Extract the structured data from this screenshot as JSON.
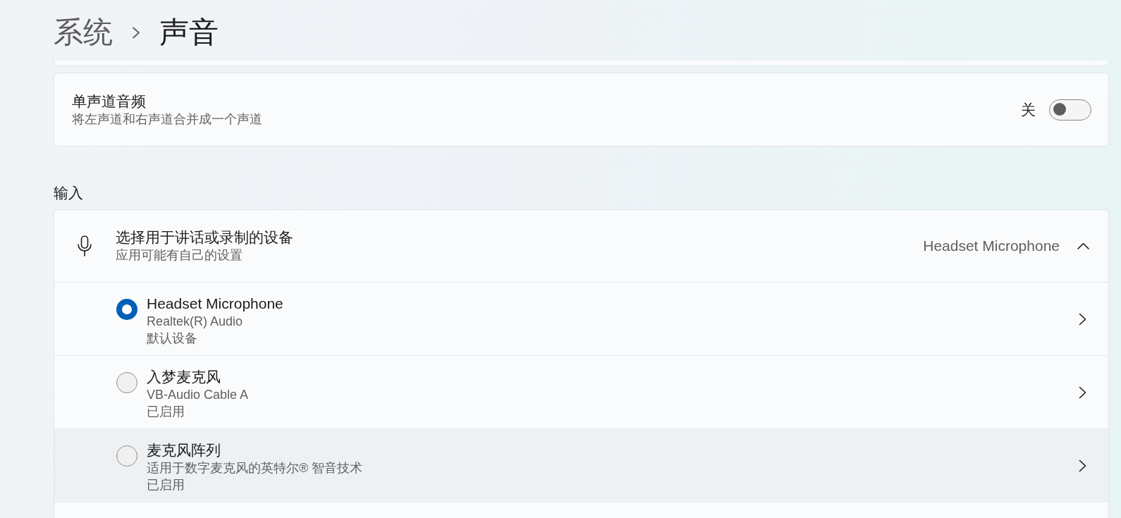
{
  "breadcrumb": [
    {
      "label": "系统",
      "current": false
    },
    {
      "label": "声音",
      "current": true
    }
  ],
  "settings": [
    {
      "kind": "toggle",
      "title": "单声道音频",
      "description": "将左声道和右声道合并成一个声道",
      "state_label": "关",
      "on": false
    }
  ],
  "input": {
    "heading": "输入",
    "picker": {
      "title": "选择用于讲话或录制的设备",
      "description": "应用可能有自己的设置",
      "value": "Headset Microphone",
      "expanded": true
    },
    "devices": [
      {
        "name": "Headset Microphone",
        "driver": "Realtek(R) Audio",
        "status": "默认设备",
        "selected": true,
        "hovered": false
      },
      {
        "name": "入梦麦克风",
        "driver": "VB-Audio Cable A",
        "status": "已启用",
        "selected": false,
        "hovered": false
      },
      {
        "name": "麦克风阵列",
        "driver": "适用于数字麦克风的英特尔® 智音技术",
        "status": "已启用",
        "selected": false,
        "hovered": true
      }
    ]
  }
}
